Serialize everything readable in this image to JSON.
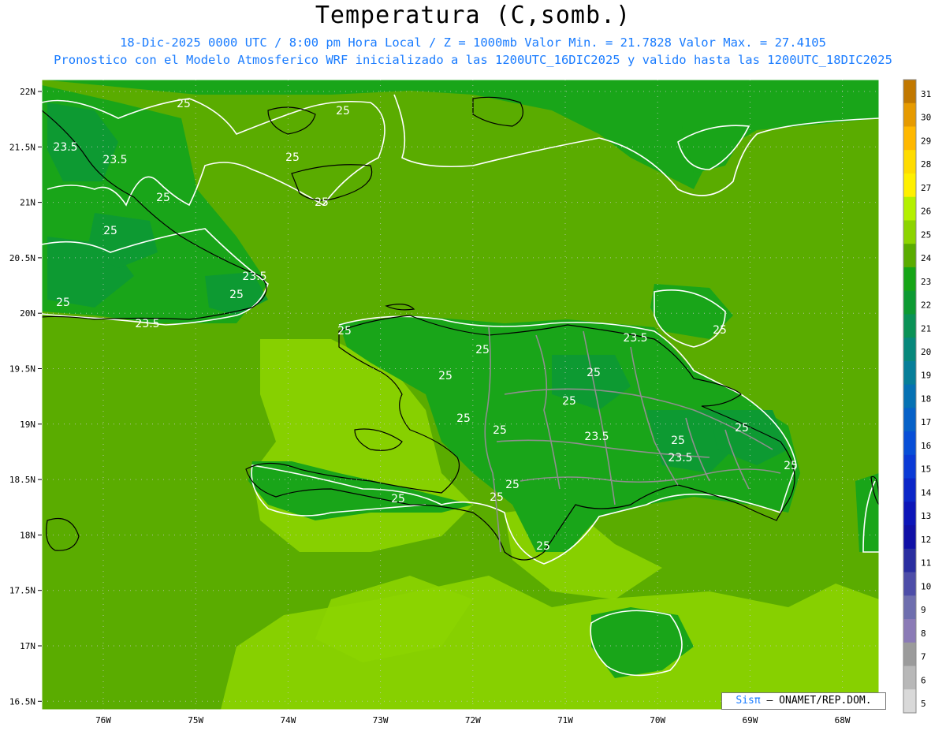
{
  "header": {
    "title": "Temperatura (C,somb.)",
    "line1": "18-Dic-2025  0000 UTC / 8:00 pm Hora Local / Z = 1000mb   Valor Min. = 21.7828  Valor Max. = 27.4105",
    "line2": "Pronostico con el Modelo Atmosferico WRF inicializado a las 1200UTC_16DIC2025 y valido hasta las  1200UTC_18DIC2025"
  },
  "map": {
    "lat_labels": [
      "22N",
      "21.5N",
      "21N",
      "20.5N",
      "20N",
      "19.5N",
      "19N",
      "18.5N",
      "18N",
      "17.5N",
      "17N",
      "16.5N"
    ],
    "lon_labels": [
      "76W",
      "75W",
      "74W",
      "73W",
      "72W",
      "71W",
      "70W",
      "69W",
      "68W"
    ],
    "contour_labels": [
      "25",
      "25",
      "23.5",
      "25",
      "23.5",
      "25",
      "25",
      "25",
      "23.5",
      "25",
      "25",
      "23.5",
      "25",
      "25",
      "25",
      "25",
      "25",
      "23.5",
      "25",
      "25",
      "25",
      "23.5",
      "25",
      "25",
      "23.5",
      "25",
      "25",
      "25",
      "25",
      "25"
    ],
    "colors": {
      "sea_base": "#5aac00",
      "warm": "#8cd400",
      "cool": "#19a519",
      "cooler": "#0d9a32",
      "border_gray": "#8f8f8f",
      "coast": "#000000",
      "contour": "#ffffff"
    }
  },
  "colorbar": {
    "levels": [
      "31",
      "30",
      "29",
      "28",
      "27",
      "26",
      "25",
      "24",
      "23",
      "22",
      "21",
      "20",
      "19",
      "18",
      "17",
      "16",
      "15",
      "14",
      "13",
      "12",
      "11",
      "10",
      "9",
      "8",
      "7",
      "6",
      "5"
    ],
    "colors": [
      "#c17800",
      "#e69a00",
      "#ffb800",
      "#ffdc00",
      "#fff000",
      "#b4f000",
      "#8cd400",
      "#5aac00",
      "#16a516",
      "#0d9a32",
      "#0a9256",
      "#07887b",
      "#067e99",
      "#0571b3",
      "#0661c8",
      "#074ed7",
      "#0a3ad6",
      "#0b26c8",
      "#0c15b8",
      "#1010a6",
      "#2a2ea0",
      "#4d4da8",
      "#6e6eae",
      "#8b7bb6",
      "#9b9b9b",
      "#b8b8b8",
      "#d9d9d9"
    ]
  },
  "credit": {
    "brand": "Sisπ",
    "text": " – ONAMET/REP.DOM."
  }
}
